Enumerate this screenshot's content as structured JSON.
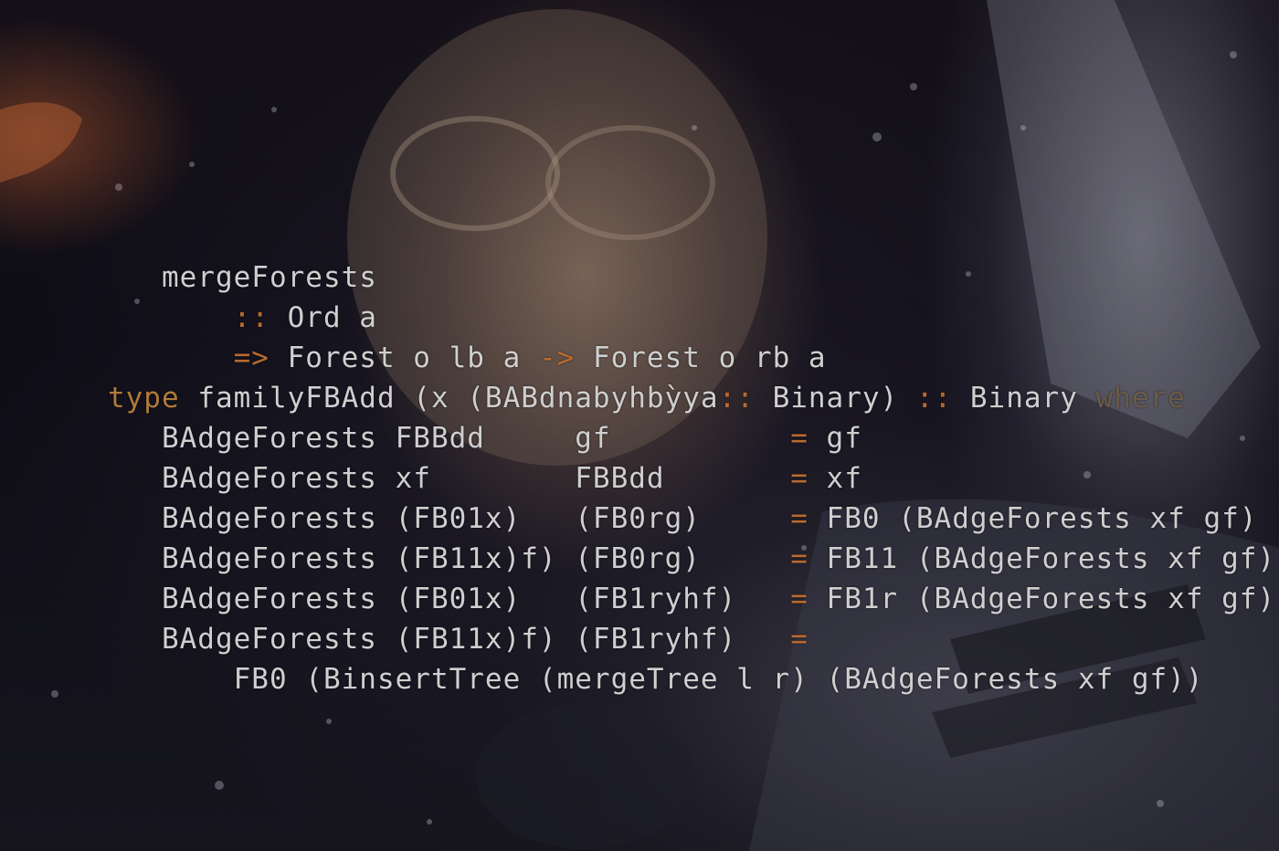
{
  "code": {
    "lines": [
      {
        "indent": "   ",
        "parts": [
          {
            "t": "mergeForests",
            "c": "plain"
          }
        ]
      },
      {
        "indent": "       ",
        "parts": [
          {
            "t": ":: ",
            "c": "op"
          },
          {
            "t": "Ord a",
            "c": "plain"
          }
        ]
      },
      {
        "indent": "       ",
        "parts": [
          {
            "t": "=> ",
            "c": "op"
          },
          {
            "t": "Forest o lb a ",
            "c": "plain"
          },
          {
            "t": "-> ",
            "c": "op"
          },
          {
            "t": "Forest o rb a",
            "c": "plain"
          }
        ]
      },
      {
        "indent": "",
        "parts": [
          {
            "t": "type ",
            "c": "kw"
          },
          {
            "t": "familyFBAdd (x (BABdnabyhbỳya",
            "c": "plain"
          },
          {
            "t": ":: ",
            "c": "op"
          },
          {
            "t": "Binary) ",
            "c": "plain"
          },
          {
            "t": ":: ",
            "c": "op"
          },
          {
            "t": "Binary ",
            "c": "plain"
          },
          {
            "t": "where",
            "c": "where"
          }
        ]
      },
      {
        "indent": "   ",
        "parts": [
          {
            "t": "BAdgeForests FBBdd     gf          ",
            "c": "plain"
          },
          {
            "t": "= ",
            "c": "op"
          },
          {
            "t": "gf",
            "c": "plain"
          }
        ]
      },
      {
        "indent": "   ",
        "parts": [
          {
            "t": "BAdgeForests xf        FBBdd       ",
            "c": "plain"
          },
          {
            "t": "= ",
            "c": "op"
          },
          {
            "t": "xf",
            "c": "plain"
          }
        ]
      },
      {
        "indent": "   ",
        "parts": [
          {
            "t": "BAdgeForests (FB01x)   (FB0rg)     ",
            "c": "plain"
          },
          {
            "t": "= ",
            "c": "op"
          },
          {
            "t": "FB0 (BAdgeForests xf gf)",
            "c": "plain"
          }
        ]
      },
      {
        "indent": "   ",
        "parts": [
          {
            "t": "BAdgeForests (FB11x)f) (FB0rg)     ",
            "c": "plain"
          },
          {
            "t": "= ",
            "c": "op"
          },
          {
            "t": "FB11 (BAdgeForests xf gf)",
            "c": "plain"
          }
        ]
      },
      {
        "indent": "   ",
        "parts": [
          {
            "t": "BAdgeForests (FB01x)   (FB1ryhf)   ",
            "c": "plain"
          },
          {
            "t": "= ",
            "c": "op"
          },
          {
            "t": "FB1r (BAdgeForests xf gf)",
            "c": "plain"
          }
        ]
      },
      {
        "indent": "   ",
        "parts": [
          {
            "t": "BAdgeForests (FB11x)f) (FB1ryhf)   ",
            "c": "plain"
          },
          {
            "t": "=",
            "c": "op"
          }
        ]
      },
      {
        "indent": "       ",
        "parts": [
          {
            "t": "FB0 (BinsertTree (mergeTree l r) (BAdgeForests xf gf))",
            "c": "plain"
          }
        ]
      }
    ]
  },
  "colors": {
    "plain": "#cfcfcf",
    "op": "#b86a30",
    "kw": "#b07a3a",
    "where": "#6b5a4a"
  }
}
